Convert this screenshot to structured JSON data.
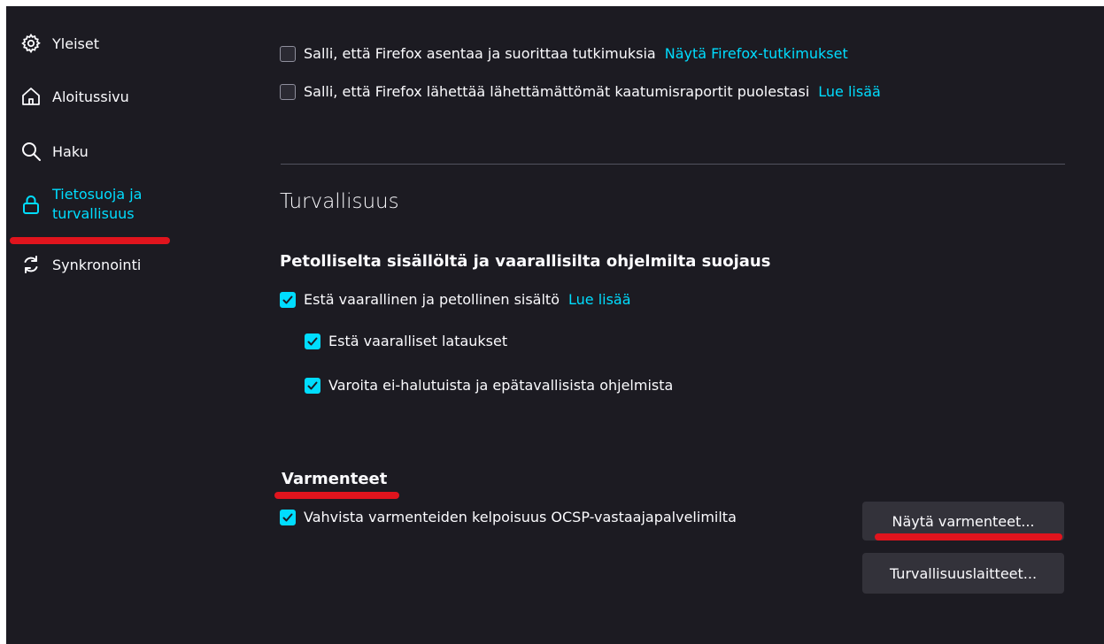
{
  "sidebar": {
    "items": [
      {
        "label": "Yleiset",
        "icon": "gear-icon"
      },
      {
        "label": "Aloitussivu",
        "icon": "home-icon"
      },
      {
        "label": "Haku",
        "icon": "search-icon"
      },
      {
        "label_line1": "Tietosuoja ja",
        "label_line2": "turvallisuus",
        "icon": "lock-icon",
        "active": true
      },
      {
        "label": "Synkronointi",
        "icon": "sync-icon"
      }
    ]
  },
  "data_collection": {
    "studies": {
      "label": "Salli, että Firefox asentaa ja suorittaa tutkimuksia",
      "link": "Näytä Firefox-tutkimukset",
      "checked": false
    },
    "crash_reports": {
      "label": "Salli, että Firefox lähettää lähettämättömät kaatumisraportit puolestasi",
      "link": "Lue lisää",
      "checked": false
    }
  },
  "security": {
    "heading": "Turvallisuus",
    "deceptive_heading": "Petolliselta sisällöltä ja vaarallisilta ohjelmilta suojaus",
    "block_dangerous": {
      "label": "Estä vaarallinen ja petollinen sisältö",
      "link": "Lue lisää",
      "checked": true
    },
    "block_downloads": {
      "label": "Estä vaaralliset lataukset",
      "checked": true
    },
    "warn_unwanted": {
      "label": "Varoita ei-halutuista ja epätavallisista ohjelmista",
      "checked": true
    }
  },
  "certificates": {
    "heading": "Varmenteet",
    "ocsp": {
      "label": "Vahvista varmenteiden kelpoisuus OCSP-vastaajapalvelimilta",
      "checked": true
    },
    "view_button": "Näytä varmenteet...",
    "devices_button": "Turvallisuuslaitteet..."
  },
  "colors": {
    "background": "#1c1b22",
    "accent": "#00ddff",
    "annotation": "#e0141d"
  }
}
